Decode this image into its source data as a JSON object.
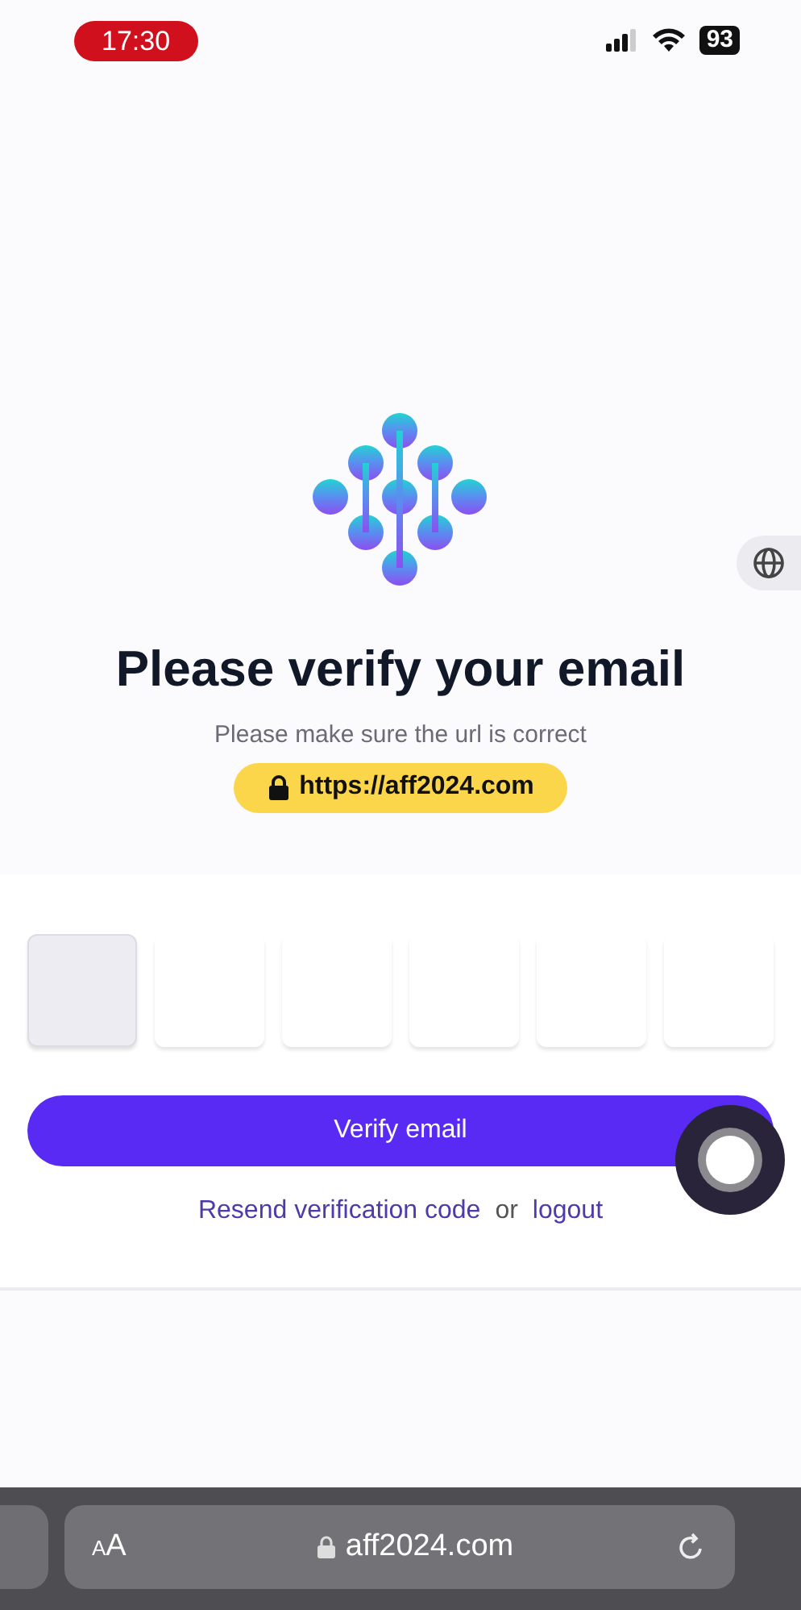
{
  "status_bar": {
    "time": "17:30",
    "battery": "93"
  },
  "title": "Please verify your email",
  "subtitle": "Please make sure the url is correct",
  "url_badge": "https://aff2024.com",
  "code_boxes": [
    {
      "selected": true
    },
    {
      "selected": false
    },
    {
      "selected": false
    },
    {
      "selected": false
    },
    {
      "selected": false
    },
    {
      "selected": false
    }
  ],
  "verify_button": "Verify email",
  "links": {
    "resend": "Resend verification code",
    "separator": "or",
    "logout": "logout"
  },
  "browser_bar": {
    "reader": "AA",
    "address": "aff2024.com"
  }
}
